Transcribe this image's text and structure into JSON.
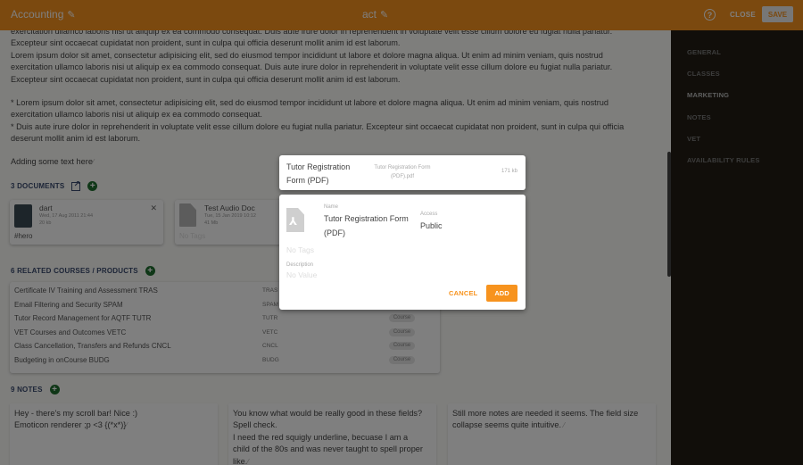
{
  "header": {
    "title": "Accounting",
    "center_title": "act",
    "help_icon": "help-circle-icon",
    "close_label": "CLOSE",
    "save_label": "SAVE",
    "accent_color": "#f7931e"
  },
  "description": {
    "lines_top": [
      "exercitation ullamco laboris nisi ut aliquip ex ea commodo consequat. Duis aute irure dolor in reprehenderit in voluptate velit esse cillum dolore eu fugiat nulla pariatur.",
      "Excepteur sint occaecat cupidatat non proident, sunt in culpa qui officia deserunt mollit anim id est laborum.",
      "Lorem ipsum dolor sit amet, consectetur adipisicing elit, sed do eiusmod tempor incididunt ut labore et dolore magna aliqua. Ut enim ad minim veniam, quis nostrud",
      "exercitation ullamco laboris nisi ut aliquip ex ea commodo consequat. Duis aute irure dolor in reprehenderit in voluptate velit esse cillum dolore eu fugiat nulla pariatur.",
      "Excepteur sint occaecat cupidatat non proident, sunt in culpa qui officia deserunt mollit anim id est laborum."
    ],
    "lines_bullets": [
      "* Lorem ipsum dolor sit amet, consectetur adipisicing elit, sed do eiusmod tempor incididunt ut labore et dolore magna aliqua. Ut enim ad minim veniam, quis nostrud",
      "exercitation ullamco laboris nisi ut aliquip ex ea commodo consequat.",
      "* Duis aute irure dolor in reprehenderit in voluptate velit esse cillum dolore eu fugiat nulla pariatur. Excepteur sint occaecat cupidatat non proident, sunt in culpa qui officia",
      "deserunt mollit anim id est laborum."
    ],
    "extra_text": "Adding some text here"
  },
  "documents": {
    "title": "3 DOCUMENTS",
    "items": [
      {
        "name": "dart",
        "date": "Wed, 17 Aug 2011 21:44",
        "size": "20 kb",
        "tags": "#hero"
      },
      {
        "name": "Test Audio Doc",
        "date": "Tue, 15 Jan 2019 10:12",
        "size": "41 Mb",
        "tags": "No Tags"
      }
    ]
  },
  "courses": {
    "title": "6 RELATED COURSES / PRODUCTS",
    "items": [
      {
        "name": "Certificate IV Training and Assessment TRAS",
        "code": "TRAS",
        "type": "Course"
      },
      {
        "name": "Email Filtering and Security SPAM",
        "code": "SPAM",
        "type": "Course"
      },
      {
        "name": "Tutor Record Management for AQTF TUTR",
        "code": "TUTR",
        "type": "Course"
      },
      {
        "name": "VET Courses and Outcomes VETC",
        "code": "VETC",
        "type": "Course"
      },
      {
        "name": "Class Cancellation, Transfers and Refunds CNCL",
        "code": "CNCL",
        "type": "Course"
      },
      {
        "name": "Budgeting in onCourse BUDG",
        "code": "BUDG",
        "type": "Course"
      }
    ]
  },
  "notes": {
    "title": "9 NOTES",
    "items": [
      {
        "lines": [
          "Hey - there's my scroll bar! Nice :)",
          "Emoticon renderer ;p <3 {(*x*)}"
        ]
      },
      {
        "lines": [
          "You know what would be really good in these fields?",
          "Spell check.",
          "I need the red squigly underline, becuase I am a",
          "child of the 80s and was never taught to spell proper",
          "like."
        ]
      },
      {
        "lines": [
          "Still more notes are needed it seems. The field size",
          "collapse seems quite intuitive."
        ]
      }
    ]
  },
  "sidebar": {
    "items": [
      {
        "label": "GENERAL",
        "active": false
      },
      {
        "label": "CLASSES",
        "active": false
      },
      {
        "label": "MARKETING",
        "active": true
      },
      {
        "label": "NOTES",
        "active": false
      },
      {
        "label": "VET",
        "active": false
      },
      {
        "label": "AVAILABILITY RULES",
        "active": false
      }
    ]
  },
  "dialog": {
    "file_title": "Tutor Registration Form (PDF)",
    "file_name": "Tutor Registration Form (PDF).pdf",
    "file_size": "171 kb",
    "name_label": "Name",
    "name_value": "Tutor Registration Form (PDF)",
    "access_label": "Access",
    "access_value": "Public",
    "tags_placeholder": "No Tags",
    "description_label": "Description",
    "description_placeholder": "No Value",
    "cancel_label": "CANCEL",
    "add_label": "ADD"
  }
}
